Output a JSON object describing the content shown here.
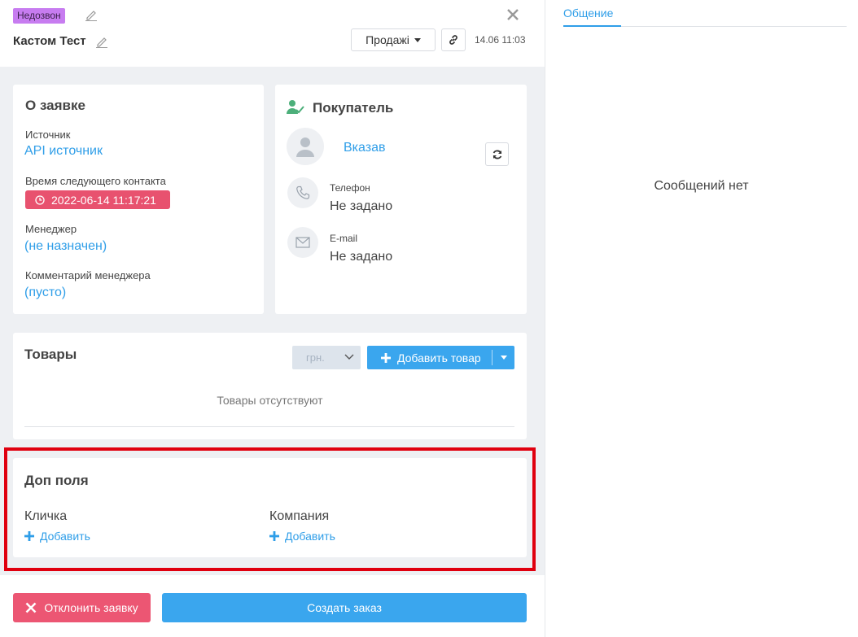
{
  "header": {
    "status_badge": "Недозвон",
    "title": "Кастом Тест",
    "pipeline": "Продажі",
    "date": "14.06 11:03"
  },
  "request": {
    "title": "О заявке",
    "source_label": "Источник",
    "source_value": "API источник",
    "next_contact_label": "Время следующего контакта",
    "next_contact_value": "2022-06-14 11:17:21",
    "manager_label": "Менеджер",
    "manager_value": "(не назначен)",
    "comment_label": "Комментарий менеджера",
    "comment_value": "(пусто)"
  },
  "buyer": {
    "title": "Покупатель",
    "name": "Вказав",
    "phone_label": "Телефон",
    "phone_value": "Не задано",
    "email_label": "E-mail",
    "email_value": "Не задано"
  },
  "products": {
    "title": "Товары",
    "currency": "грн.",
    "add_label": "Добавить товар",
    "empty_text": "Товары отсутствуют"
  },
  "extra": {
    "title": "Доп поля",
    "fields": [
      {
        "label": "Кличка",
        "add": "Добавить"
      },
      {
        "label": "Компания",
        "add": "Добавить"
      }
    ]
  },
  "actions": {
    "decline": "Отклонить заявку",
    "create": "Создать заказ"
  },
  "chat": {
    "tab": "Общение",
    "empty": "Сообщений нет"
  },
  "colors": {
    "accent": "#2f9ee8",
    "badge": "#c77cf0",
    "danger": "#e8526f",
    "highlight": "#e0000f"
  }
}
